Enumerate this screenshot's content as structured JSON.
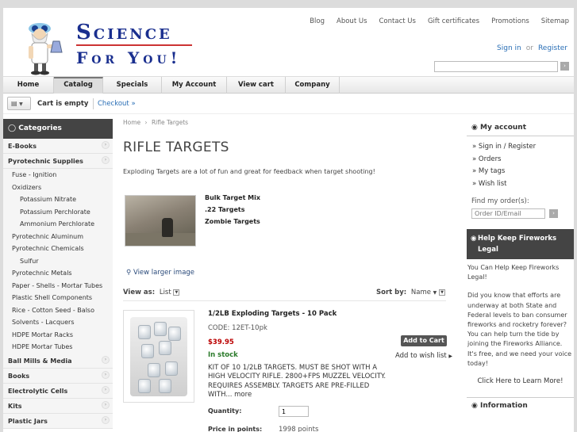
{
  "header": {
    "logo": {
      "line1": "Science",
      "line2": "For You!"
    },
    "top_links": [
      "Blog",
      "About Us",
      "Contact Us",
      "Gift certificates",
      "Promotions",
      "Sitemap"
    ],
    "sign_in": "Sign in",
    "or": "or",
    "register": "Register",
    "search_value": ""
  },
  "nav": [
    "Home",
    "Catalog",
    "Specials",
    "My Account",
    "View cart",
    "Company"
  ],
  "cart": {
    "status": "Cart is empty",
    "checkout": "Checkout »"
  },
  "categories": {
    "title": "Categories",
    "items": [
      {
        "label": "E-Books",
        "level": 0,
        "expand": true
      },
      {
        "label": "Pyrotechnic Supplies",
        "level": 0,
        "expand": true
      },
      {
        "label": "Fuse - Ignition",
        "level": 1
      },
      {
        "label": "Oxidizers",
        "level": 1
      },
      {
        "label": "Potassium Nitrate",
        "level": 2
      },
      {
        "label": "Potassium Perchlorate",
        "level": 2
      },
      {
        "label": "Ammonium Perchlorate",
        "level": 2
      },
      {
        "label": "Pyrotechnic Aluminum",
        "level": 1
      },
      {
        "label": "Pyrotechnic Chemicals",
        "level": 1
      },
      {
        "label": "Sulfur",
        "level": 2
      },
      {
        "label": "Pyrotechnic Metals",
        "level": 1
      },
      {
        "label": "Paper - Shells - Mortar Tubes",
        "level": 1
      },
      {
        "label": "Plastic Shell Components",
        "level": 1
      },
      {
        "label": "Rice - Cotton Seed - Balso",
        "level": 1
      },
      {
        "label": "Solvents - Lacquers",
        "level": 1
      },
      {
        "label": "HDPE Mortar Racks",
        "level": 1
      },
      {
        "label": "HDPE Mortar Tubes",
        "level": 1
      },
      {
        "label": "Ball Mills & Media",
        "level": 0,
        "expand": true
      },
      {
        "label": "Books",
        "level": 0,
        "expand": true
      },
      {
        "label": "Electrolytic Cells",
        "level": 0,
        "expand": true
      },
      {
        "label": "Kits",
        "level": 0,
        "expand": true
      },
      {
        "label": "Plastic Jars",
        "level": 0,
        "expand": true
      }
    ]
  },
  "main": {
    "breadcrumb": {
      "home": "Home",
      "sep": "›",
      "current": "Rifle Targets"
    },
    "title": "RIFLE TARGETS",
    "description": "Exploding Targets are a lot of fun and great for feedback when target shooting!",
    "subcategories": [
      "Bulk Target Mix",
      ".22 Targets",
      "Zombie Targets"
    ],
    "view_larger": "View larger image",
    "view_as_label": "View as:",
    "view_as_value": "List",
    "sort_label": "Sort by:",
    "sort_value": "Name",
    "product": {
      "title": "1/2LB Exploding Targets - 10 Pack",
      "code": "CODE: 12ET-10pk",
      "price": "$39.95",
      "stock": "In stock",
      "description": "KIT OF 10 1/2LB TARGETS.  MUST BE SHOT WITH A HIGH VELOCITY RIFLE. 2800+FPS MUZZEL VELOCITY. REQUIRES ASSEMBLY. TARGETS ARE PRE-FILLED WITH...",
      "more": "more",
      "add_to_cart": "Add to Cart",
      "wish_list": "Add to wish list",
      "quantity_label": "Quantity:",
      "quantity": "1",
      "points_label": "Price in points:",
      "points": "1998 points"
    }
  },
  "account": {
    "title": "My account",
    "links": [
      "Sign in / Register",
      "Orders",
      "My tags",
      "Wish list"
    ],
    "find_label": "Find my order(s):",
    "find_placeholder": "Order ID/Email"
  },
  "help": {
    "title": "Help Keep Fireworks Legal",
    "intro": "You Can Help Keep Fireworks Legal!",
    "body": "Did you know that efforts are underway at both State and Federal levels to ban consumer fireworks and rocketry forever? You can help turn the tide by joining the Fireworks Alliance. It's free, and we need your voice today!",
    "learn_more": "Click Here to Learn More!"
  },
  "information": {
    "title": "Information"
  },
  "colors": {
    "accent_link": "#2a6fb6",
    "price": "#bb0000",
    "stock": "#2a7a2a",
    "dark_header": "#444444",
    "logo_blue": "#1a2f8f"
  }
}
